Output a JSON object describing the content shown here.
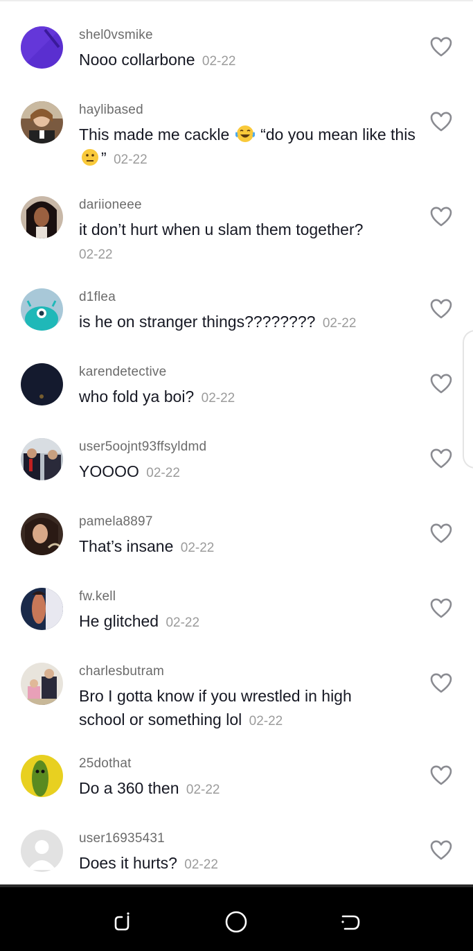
{
  "comments": [
    {
      "username": "shel0vsmike",
      "text": "Nooo collarbone",
      "date": "02-22"
    },
    {
      "username": "haylibased",
      "text_part1": "This made me cackle",
      "text_part2": "“do you mean like this",
      "text_part3": "”",
      "date": "02-22",
      "emojis": [
        "laughing-crying-emoji",
        "neutral-face-emoji"
      ]
    },
    {
      "username": "dariioneee",
      "text": "it don’t hurt when u slam them together?",
      "date": "02-22"
    },
    {
      "username": "d1flea",
      "text": "is he on stranger things????????",
      "date": "02-22"
    },
    {
      "username": "karendetective",
      "text": "who fold ya boi?",
      "date": "02-22"
    },
    {
      "username": "user5oojnt93ffsyldmd",
      "text": "YOOOO",
      "date": "02-22"
    },
    {
      "username": "pamela8897",
      "text": "That’s insane",
      "date": "02-22"
    },
    {
      "username": "fw.kell",
      "text": "He glitched",
      "date": "02-22"
    },
    {
      "username": "charlesbutram",
      "text": "Bro I gotta know if you wrestled in high school or something lol",
      "date": "02-22"
    },
    {
      "username": "25dothat",
      "text": "Do a 360 then",
      "date": "02-22"
    },
    {
      "username": "user16935431",
      "text": "Does it hurts?",
      "date": "02-22"
    }
  ],
  "icons": {
    "like": "heart-outline-icon",
    "nav_recents": "recent-apps-icon",
    "nav_home": "home-circle-icon",
    "nav_back": "back-icon"
  },
  "colors": {
    "text": "#161823",
    "username": "#6b6b6b",
    "date": "#9b9b9b",
    "heart": "#8a8b91",
    "navbar": "#000000"
  }
}
